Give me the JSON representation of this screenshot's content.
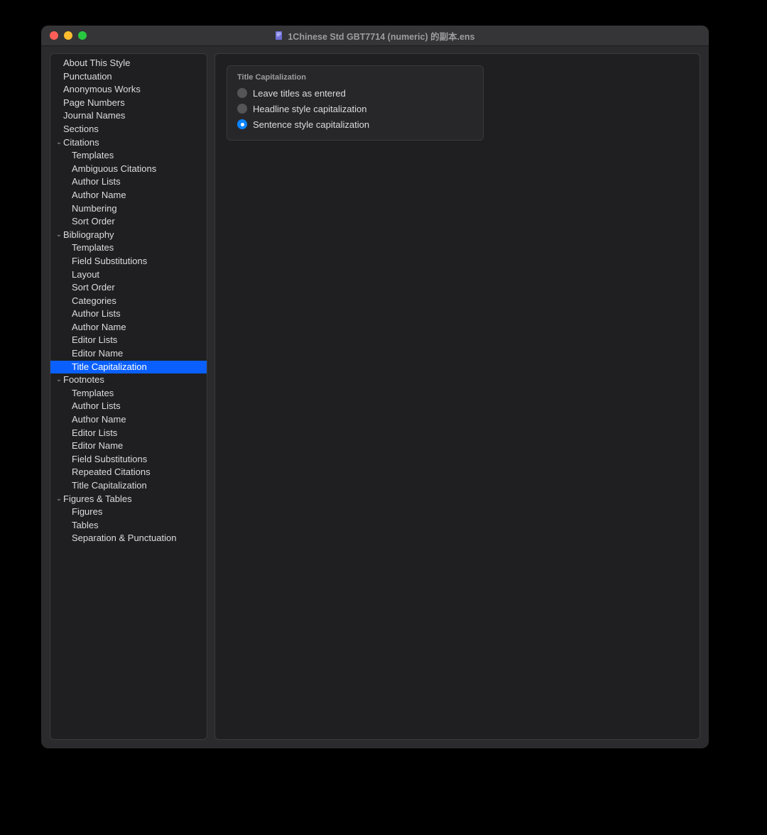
{
  "window": {
    "title": "1Chinese Std GBT7714 (numeric) 的副本.ens"
  },
  "sidebar": {
    "items": [
      {
        "label": "About This Style",
        "level": 0,
        "expandable": false
      },
      {
        "label": "Punctuation",
        "level": 0,
        "expandable": false
      },
      {
        "label": "Anonymous Works",
        "level": 0,
        "expandable": false
      },
      {
        "label": "Page Numbers",
        "level": 0,
        "expandable": false
      },
      {
        "label": "Journal Names",
        "level": 0,
        "expandable": false
      },
      {
        "label": "Sections",
        "level": 0,
        "expandable": false
      },
      {
        "label": "Citations",
        "level": 0,
        "expandable": true,
        "expanded": true
      },
      {
        "label": "Templates",
        "level": 1,
        "expandable": false
      },
      {
        "label": "Ambiguous Citations",
        "level": 1,
        "expandable": false
      },
      {
        "label": "Author Lists",
        "level": 1,
        "expandable": false
      },
      {
        "label": "Author Name",
        "level": 1,
        "expandable": false
      },
      {
        "label": "Numbering",
        "level": 1,
        "expandable": false
      },
      {
        "label": "Sort Order",
        "level": 1,
        "expandable": false
      },
      {
        "label": "Bibliography",
        "level": 0,
        "expandable": true,
        "expanded": true
      },
      {
        "label": "Templates",
        "level": 1,
        "expandable": false
      },
      {
        "label": "Field Substitutions",
        "level": 1,
        "expandable": false
      },
      {
        "label": "Layout",
        "level": 1,
        "expandable": false
      },
      {
        "label": "Sort Order",
        "level": 1,
        "expandable": false
      },
      {
        "label": "Categories",
        "level": 1,
        "expandable": false
      },
      {
        "label": "Author Lists",
        "level": 1,
        "expandable": false
      },
      {
        "label": "Author Name",
        "level": 1,
        "expandable": false
      },
      {
        "label": "Editor Lists",
        "level": 1,
        "expandable": false
      },
      {
        "label": "Editor Name",
        "level": 1,
        "expandable": false
      },
      {
        "label": "Title Capitalization",
        "level": 1,
        "expandable": false,
        "selected": true
      },
      {
        "label": "Footnotes",
        "level": 0,
        "expandable": true,
        "expanded": true
      },
      {
        "label": "Templates",
        "level": 1,
        "expandable": false
      },
      {
        "label": "Author Lists",
        "level": 1,
        "expandable": false
      },
      {
        "label": "Author Name",
        "level": 1,
        "expandable": false
      },
      {
        "label": "Editor Lists",
        "level": 1,
        "expandable": false
      },
      {
        "label": "Editor Name",
        "level": 1,
        "expandable": false
      },
      {
        "label": "Field Substitutions",
        "level": 1,
        "expandable": false
      },
      {
        "label": "Repeated Citations",
        "level": 1,
        "expandable": false
      },
      {
        "label": "Title Capitalization",
        "level": 1,
        "expandable": false
      },
      {
        "label": "Figures & Tables",
        "level": 0,
        "expandable": true,
        "expanded": true
      },
      {
        "label": "Figures",
        "level": 1,
        "expandable": false
      },
      {
        "label": "Tables",
        "level": 1,
        "expandable": false
      },
      {
        "label": "Separation & Punctuation",
        "level": 1,
        "expandable": false
      }
    ]
  },
  "detail": {
    "group_title": "Title Capitalization",
    "radios": [
      {
        "label": "Leave titles as entered",
        "checked": false
      },
      {
        "label": "Headline style capitalization",
        "checked": false
      },
      {
        "label": "Sentence style capitalization",
        "checked": true
      }
    ]
  }
}
